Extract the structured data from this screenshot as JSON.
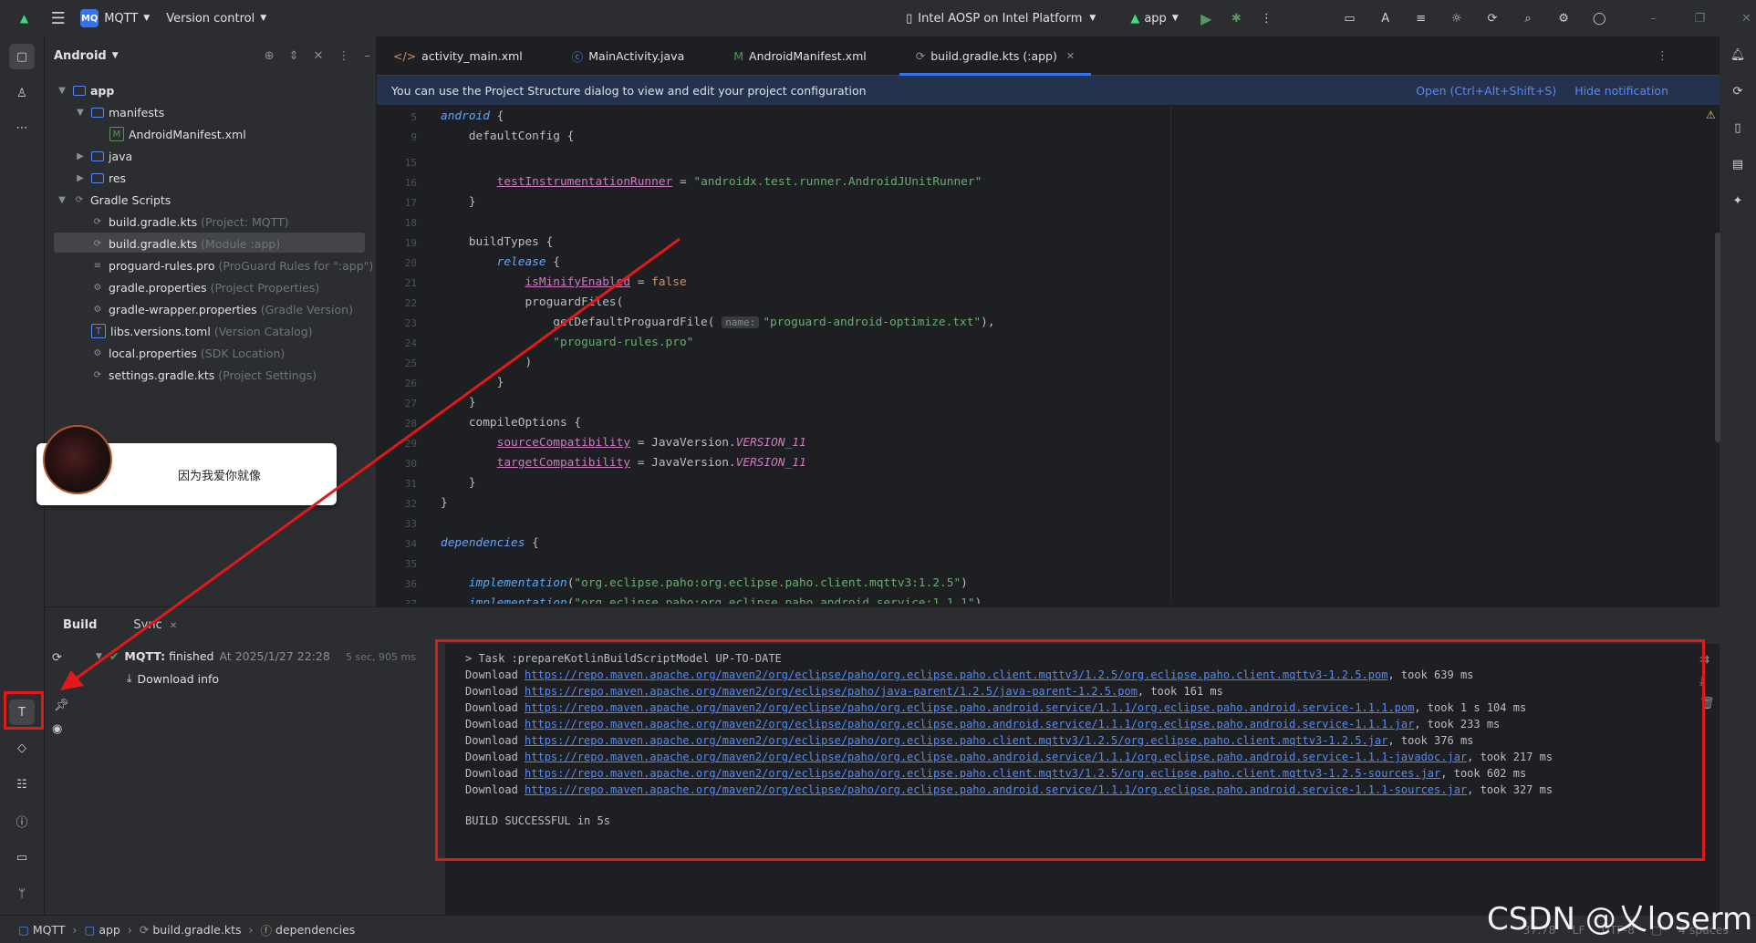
{
  "titlebar": {
    "project_badge": "MQ",
    "project_name": "MQTT",
    "vcs": "Version control",
    "device": "Intel AOSP on Intel Platform",
    "run_config": "app"
  },
  "project_panel": {
    "view": "Android",
    "tree": [
      {
        "label": "app",
        "hint": ""
      },
      {
        "label": "manifests",
        "hint": ""
      },
      {
        "label": "AndroidManifest.xml",
        "hint": ""
      },
      {
        "label": "java",
        "hint": ""
      },
      {
        "label": "res",
        "hint": ""
      },
      {
        "label": "Gradle Scripts",
        "hint": ""
      },
      {
        "label": "build.gradle.kts",
        "hint": "(Project: MQTT)"
      },
      {
        "label": "build.gradle.kts",
        "hint": "(Module :app)"
      },
      {
        "label": "proguard-rules.pro",
        "hint": "(ProGuard Rules for \":app\")"
      },
      {
        "label": "gradle.properties",
        "hint": "(Project Properties)"
      },
      {
        "label": "gradle-wrapper.properties",
        "hint": "(Gradle Version)"
      },
      {
        "label": "libs.versions.toml",
        "hint": "(Version Catalog)"
      },
      {
        "label": "local.properties",
        "hint": "(SDK Location)"
      },
      {
        "label": "settings.gradle.kts",
        "hint": "(Project Settings)"
      }
    ]
  },
  "popup": {
    "text": "因为我爱你就像"
  },
  "editor": {
    "tabs": [
      "activity_main.xml",
      "MainActivity.java",
      "AndroidManifest.xml",
      "build.gradle.kts (:app)"
    ],
    "notice": "You can use the Project Structure dialog to view and edit your project configuration",
    "notice_open": "Open (Ctrl+Alt+Shift+S)",
    "notice_hide": "Hide notification",
    "line_numbers": [
      "5",
      "9",
      "15",
      "16",
      "17",
      "18",
      "19",
      "20",
      "21",
      "22",
      "23",
      "24",
      "25",
      "26",
      "27",
      "28",
      "29",
      "30",
      "31",
      "32",
      "33",
      "34",
      "35",
      "36",
      "37"
    ]
  },
  "build_panel": {
    "tab_build": "Build",
    "tab_sync": "Sync",
    "status_project": "MQTT:",
    "status_text": "finished",
    "status_time": "At 2025/1/27 22:28",
    "duration": "5 sec, 905 ms",
    "download_info": "Download info",
    "console": {
      "task": "> Task :prepareKotlinBuildScriptModel UP-TO-DATE",
      "downloads": [
        {
          "url": "https://repo.maven.apache.org/maven2/org/eclipse/paho/org.eclipse.paho.client.mqttv3/1.2.5/org.eclipse.paho.client.mqttv3-1.2.5.pom",
          "took": ", took 639 ms"
        },
        {
          "url": "https://repo.maven.apache.org/maven2/org/eclipse/paho/java-parent/1.2.5/java-parent-1.2.5.pom",
          "took": ", took 161 ms"
        },
        {
          "url": "https://repo.maven.apache.org/maven2/org/eclipse/paho/org.eclipse.paho.android.service/1.1.1/org.eclipse.paho.android.service-1.1.1.pom",
          "took": ", took 1 s 104 ms"
        },
        {
          "url": "https://repo.maven.apache.org/maven2/org/eclipse/paho/org.eclipse.paho.android.service/1.1.1/org.eclipse.paho.android.service-1.1.1.jar",
          "took": ", took 233 ms"
        },
        {
          "url": "https://repo.maven.apache.org/maven2/org/eclipse/paho/org.eclipse.paho.client.mqttv3/1.2.5/org.eclipse.paho.client.mqttv3-1.2.5.jar",
          "took": ", took 376 ms"
        },
        {
          "url": "https://repo.maven.apache.org/maven2/org/eclipse/paho/org.eclipse.paho.android.service/1.1.1/org.eclipse.paho.android.service-1.1.1-javadoc.jar",
          "took": ", took 217 ms"
        },
        {
          "url": "https://repo.maven.apache.org/maven2/org/eclipse/paho/org.eclipse.paho.client.mqttv3/1.2.5/org.eclipse.paho.client.mqttv3-1.2.5-sources.jar",
          "took": ", took 602 ms"
        },
        {
          "url": "https://repo.maven.apache.org/maven2/org/eclipse/paho/org.eclipse.paho.android.service/1.1.1/org.eclipse.paho.android.service-1.1.1-sources.jar",
          "took": ", took 327 ms"
        }
      ],
      "download_label": "Download",
      "result": "BUILD SUCCESSFUL in 5s"
    }
  },
  "statusbar": {
    "crumbs": [
      "MQTT",
      "app",
      "build.gradle.kts",
      "dependencies"
    ],
    "position": "37:78",
    "line_sep": "LF",
    "encoding": "UTF-8",
    "indent": "4 spaces"
  },
  "watermark": "CSDN @乂loserm",
  "colors": {
    "annotation_red": "#e0191b",
    "accent": "#3574f0"
  }
}
